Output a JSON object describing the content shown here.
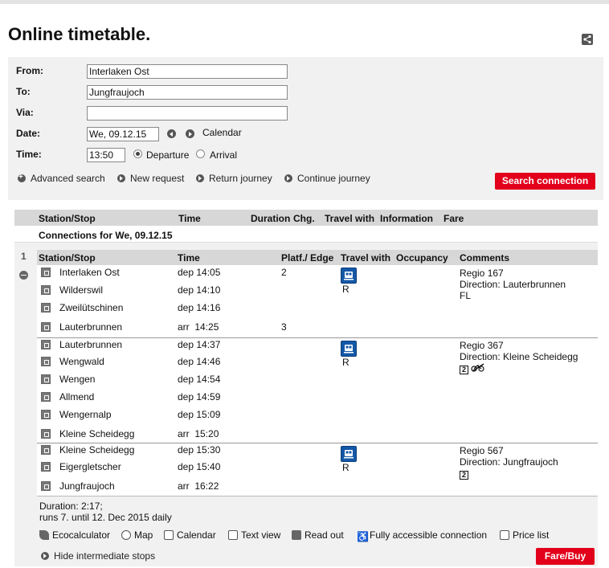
{
  "title": "Online timetable.",
  "form": {
    "from_label": "From:",
    "from_value": "Interlaken Ost",
    "to_label": "To:",
    "to_value": "Jungfraujoch",
    "via_label": "Via:",
    "via_value": "",
    "date_label": "Date:",
    "date_value": "We, 09.12.15",
    "calendar_label": "Calendar",
    "time_label": "Time:",
    "time_value": "13:50",
    "departure_label": "Departure",
    "arrival_label": "Arrival",
    "links": {
      "advanced": "Advanced search",
      "new": "New request",
      "return": "Return journey",
      "continue": "Continue journey"
    },
    "search_button": "Search connection"
  },
  "results": {
    "headers": {
      "station": "Station/Stop",
      "time": "Time",
      "duration": "Duration",
      "chg": "Chg.",
      "travel": "Travel with",
      "info": "Information",
      "fare": "Fare"
    },
    "connections_for": "Connections for We, 09.12.15",
    "connection_number": "1",
    "detail_headers": {
      "station": "Station/Stop",
      "time": "Time",
      "platf": "Platf./ Edge",
      "travel": "Travel with",
      "occupancy": "Occupancy",
      "comments": "Comments"
    },
    "segments": [
      {
        "category": "R",
        "comment_line1": "Regio 167",
        "comment_line2": "Direction: Lauterbrunnen",
        "comment_line3": "FL",
        "stops": [
          {
            "name": "Interlaken Ost",
            "time": "dep 14:05",
            "platform": "2"
          },
          {
            "name": "Wilderswil",
            "time": "dep 14:10",
            "platform": ""
          },
          {
            "name": "Zweilütschinen",
            "time": "dep 14:16",
            "platform": ""
          },
          {
            "name": "Lauterbrunnen",
            "time": "arr  14:25",
            "platform": "3"
          }
        ]
      },
      {
        "category": "R",
        "comment_line1": "Regio 367",
        "comment_line2": "Direction: Kleine Scheidegg",
        "seat_class": "2",
        "stops": [
          {
            "name": "Lauterbrunnen",
            "time": "dep 14:37",
            "platform": ""
          },
          {
            "name": "Wengwald",
            "time": "dep 14:46",
            "platform": ""
          },
          {
            "name": "Wengen",
            "time": "dep 14:54",
            "platform": ""
          },
          {
            "name": "Allmend",
            "time": "dep 14:59",
            "platform": ""
          },
          {
            "name": "Wengernalp",
            "time": "dep 15:09",
            "platform": ""
          },
          {
            "name": "Kleine Scheidegg",
            "time": "arr  15:20",
            "platform": ""
          }
        ]
      },
      {
        "category": "R",
        "comment_line1": "Regio 567",
        "comment_line2": "Direction: Jungfraujoch",
        "seat_class": "2",
        "stops": [
          {
            "name": "Kleine Scheidegg",
            "time": "dep 15:30",
            "platform": ""
          },
          {
            "name": "Eigergletscher",
            "time": "dep 15:40",
            "platform": ""
          },
          {
            "name": "Jungfraujoch",
            "time": "arr  16:22",
            "platform": ""
          }
        ]
      }
    ],
    "duration_line": "Duration: 2:17;",
    "runs_line": "runs 7. until 12. Dec 2015 daily",
    "tools": {
      "eco": "Ecocalculator",
      "map": "Map",
      "calendar": "Calendar",
      "text": "Text view",
      "read": "Read out",
      "access": "Fully accessible connection",
      "price": "Price list"
    },
    "hide_stops": "Hide intermediate stops",
    "fare_button": "Fare/Buy"
  },
  "colors": {
    "accent_red": "#e2001a",
    "train_blue": "#1558a7",
    "panel_grey": "#f1f1f1",
    "header_grey": "#d7d7d7"
  },
  "icons": [
    "share-icon",
    "prev-day-icon",
    "next-day-icon",
    "stop-icon",
    "train-icon",
    "no-bicycle-icon",
    "collapse-icon",
    "ecocalculator-icon",
    "map-icon",
    "calendar-icon",
    "text-view-icon",
    "read-out-icon",
    "wheelchair-icon",
    "price-list-icon"
  ]
}
